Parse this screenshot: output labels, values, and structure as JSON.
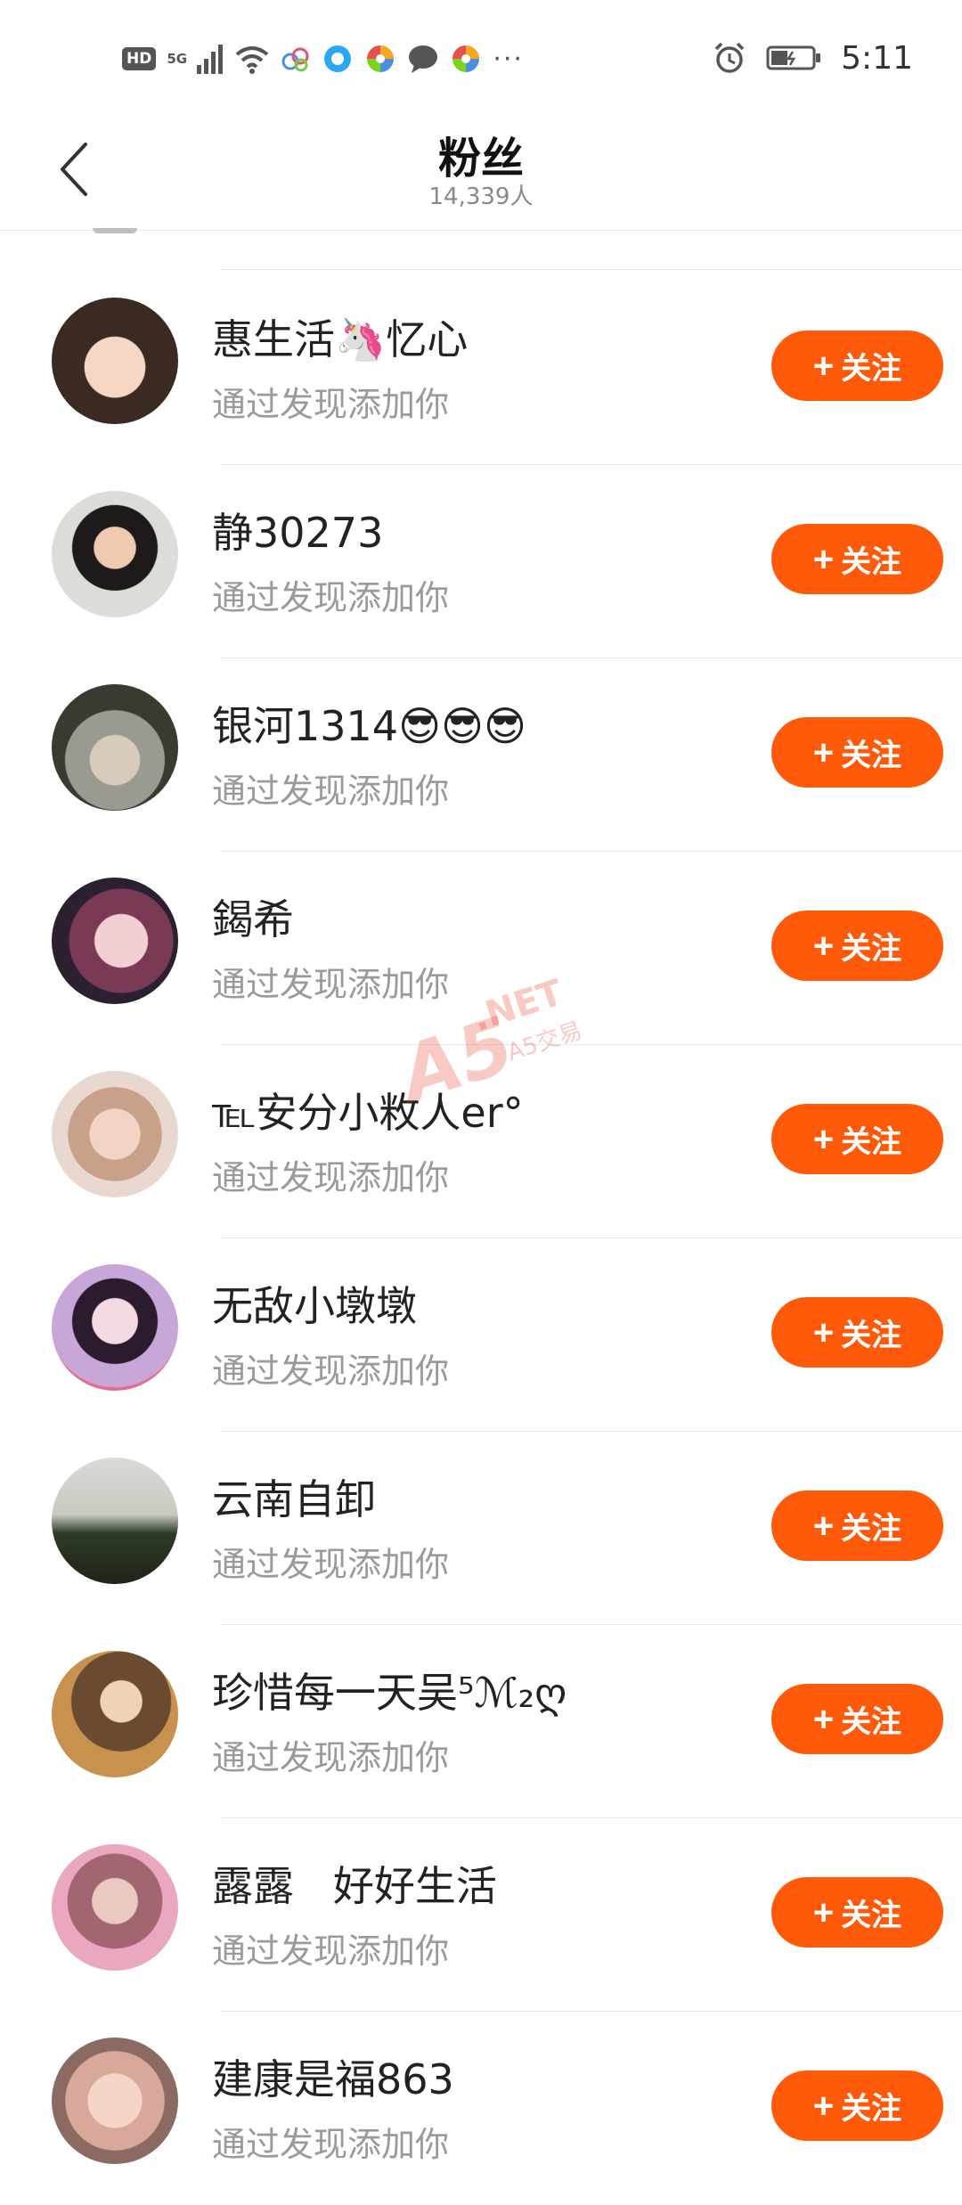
{
  "status_bar": {
    "hd": "HD",
    "network": "5G",
    "more": "···",
    "time": "5:11"
  },
  "header": {
    "title": "粉丝",
    "subtitle": "14,339人"
  },
  "follow_label": "关注",
  "follow_plus": "+",
  "rows": [
    {
      "name": "惠生活🦄忆心",
      "desc": "通过发现添加你"
    },
    {
      "name": "静30273",
      "desc": "通过发现添加你"
    },
    {
      "name": "银河1314😎😎😎",
      "desc": "通过发现添加你"
    },
    {
      "name": "鍻希",
      "desc": "通过发现添加你"
    },
    {
      "name": "℡安分小敉人er°",
      "desc": "通过发现添加你"
    },
    {
      "name": "无敌小墩墩",
      "desc": "通过发现添加你"
    },
    {
      "name": "云南自卸",
      "desc": "通过发现添加你"
    },
    {
      "name": "珍惜每一天吴⁵ℳ₂ღ",
      "desc": "通过发现添加你"
    },
    {
      "name": "露露   好好生活",
      "desc": "通过发现添加你"
    },
    {
      "name": "建康是福863",
      "desc": "通过发现添加你"
    }
  ],
  "watermark": {
    "main": "A5",
    "net": ".NET",
    "sub": "A5交易"
  }
}
